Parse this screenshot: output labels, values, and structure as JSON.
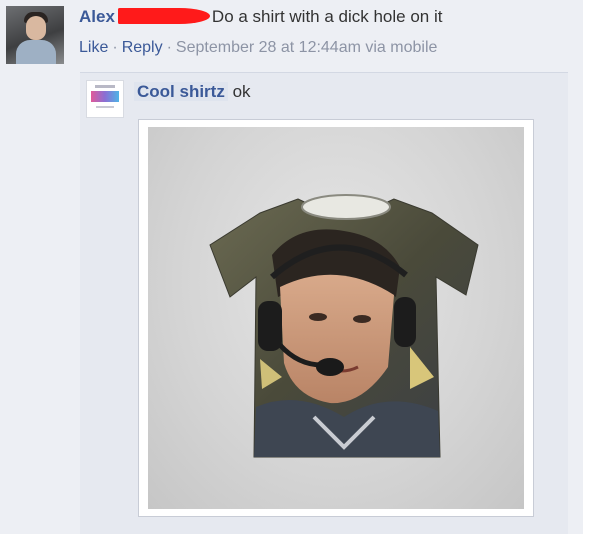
{
  "comment": {
    "author": "Alex",
    "text": "Do a shirt with a dick hole on it",
    "actions": {
      "like": "Like",
      "reply": "Reply"
    },
    "timestamp": "September 28 at 12:44am via mobile"
  },
  "reply": {
    "author": "Cool shirtz",
    "text": "ok",
    "attachment": "t-shirt with printed photo of a man wearing a headset"
  },
  "colors": {
    "link": "#3b5998",
    "meta": "#8d94a5",
    "redaction": "#ff1a1a",
    "background": "#edeff4"
  }
}
